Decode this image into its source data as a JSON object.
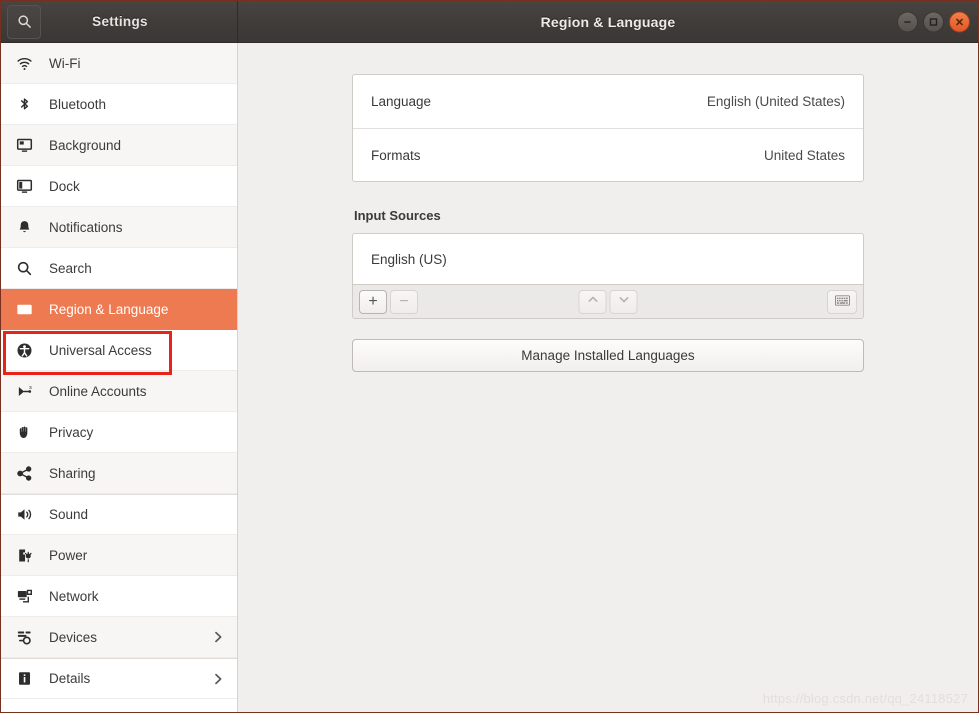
{
  "window": {
    "app_title": "Settings",
    "page_title": "Region & Language",
    "search_icon": "search-icon",
    "controls": {
      "minimize": "minimize-icon",
      "maximize": "maximize-icon",
      "close": "close-icon"
    },
    "accent_color": "#ee7a51",
    "titlebar_color": "#413d3b",
    "annotation_color": "#e8231a"
  },
  "sidebar": {
    "items": [
      {
        "label": "Wi-Fi",
        "icon": "wifi-icon",
        "selected": false,
        "chevron": false
      },
      {
        "label": "Bluetooth",
        "icon": "bluetooth-icon",
        "selected": false,
        "chevron": false
      },
      {
        "label": "Background",
        "icon": "background-icon",
        "selected": false,
        "chevron": false
      },
      {
        "label": "Dock",
        "icon": "dock-icon",
        "selected": false,
        "chevron": false
      },
      {
        "label": "Notifications",
        "icon": "bell-icon",
        "selected": false,
        "chevron": false
      },
      {
        "label": "Search",
        "icon": "search-icon",
        "selected": false,
        "chevron": false
      },
      {
        "label": "Region & Language",
        "icon": "region-language-icon",
        "selected": true,
        "chevron": false
      },
      {
        "label": "Universal Access",
        "icon": "accessibility-icon",
        "selected": false,
        "chevron": false
      },
      {
        "label": "Online Accounts",
        "icon": "online-accounts-icon",
        "selected": false,
        "chevron": false
      },
      {
        "label": "Privacy",
        "icon": "hand-icon",
        "selected": false,
        "chevron": false
      },
      {
        "label": "Sharing",
        "icon": "share-icon",
        "selected": false,
        "chevron": false
      },
      {
        "label": "Sound",
        "icon": "speaker-icon",
        "selected": false,
        "chevron": false
      },
      {
        "label": "Power",
        "icon": "battery-icon",
        "selected": false,
        "chevron": false
      },
      {
        "label": "Network",
        "icon": "network-icon",
        "selected": false,
        "chevron": false
      },
      {
        "label": "Devices",
        "icon": "devices-icon",
        "selected": false,
        "chevron": true
      },
      {
        "label": "Details",
        "icon": "info-icon",
        "selected": false,
        "chevron": true
      }
    ]
  },
  "main": {
    "settings_rows": [
      {
        "key": "Language",
        "value": "English (United States)"
      },
      {
        "key": "Formats",
        "value": "United States"
      }
    ],
    "input_sources": {
      "section_title": "Input Sources",
      "sources": [
        "English (US)"
      ],
      "toolbar": {
        "add_label": "+",
        "remove_label": "−",
        "move_up_icon": "chevron-up-icon",
        "move_down_icon": "chevron-down-icon",
        "keyboard_icon": "keyboard-icon"
      }
    },
    "manage_languages_label": "Manage Installed Languages"
  },
  "watermark": {
    "text": "https://blog.csdn.net/qq_24118527"
  }
}
